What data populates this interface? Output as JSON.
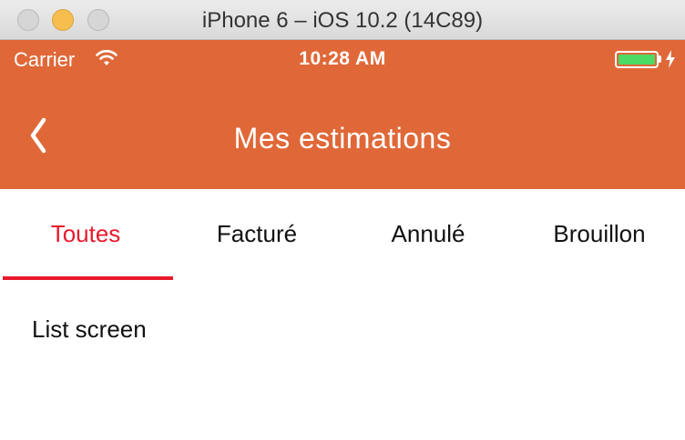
{
  "window": {
    "title": "iPhone 6 – iOS 10.2 (14C89)"
  },
  "statusbar": {
    "carrier": "Carrier",
    "time": "10:28 AM",
    "battery_level": 1.0
  },
  "navbar": {
    "title": "Mes estimations",
    "background_color": "#e06838"
  },
  "tabs": {
    "active_index": 0,
    "accent_color": "#e8192c",
    "items": [
      {
        "label": "Toutes"
      },
      {
        "label": "Facturé"
      },
      {
        "label": "Annulé"
      },
      {
        "label": "Brouillon"
      }
    ]
  },
  "content": {
    "text": "List screen"
  },
  "icons": {
    "back": "chevron-left-icon",
    "wifi": "wifi-icon",
    "battery": "battery-icon",
    "charging": "charging-bolt-icon"
  }
}
